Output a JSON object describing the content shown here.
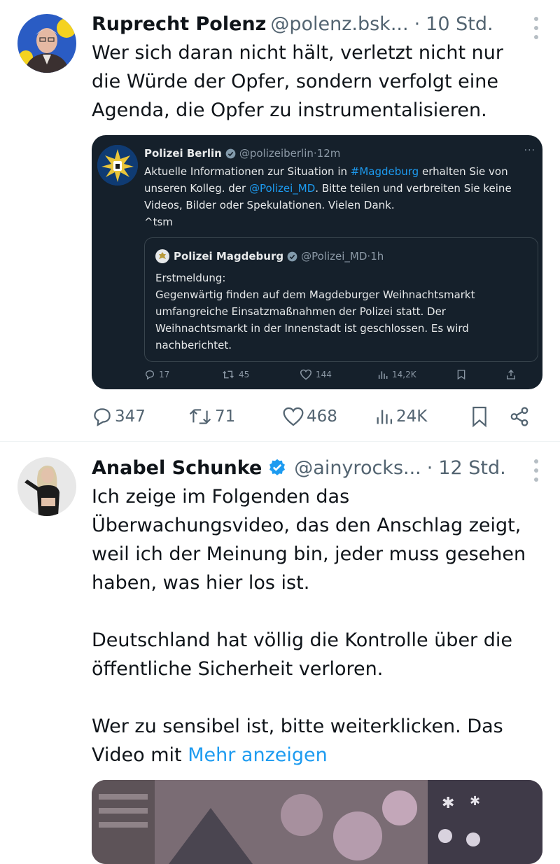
{
  "posts": [
    {
      "author": {
        "name": "Ruprecht Polenz",
        "handle": "@polenz.bsk...",
        "time": "10 Std."
      },
      "text": [
        "Wer sich daran nicht hält, verletzt nicht nur",
        "die Würde der Opfer, sondern verfolgt eine",
        "Agenda, die Opfer zu instrumentalisieren."
      ],
      "embed": {
        "author": {
          "name": "Polizei Berlin",
          "handle": "@polizeiberlin",
          "time": "12m"
        },
        "text_line1_pre": "Aktuelle Informationen zur Situation in ",
        "text_line1_link": "#Magdeburg",
        "text_line1_post": " erhalten Sie von",
        "text_line2_pre": "unseren Kolleg. der ",
        "text_line2_link": "@Polizei_MD",
        "text_line2_post": ". Bitte teilen und verbreiten Sie keine",
        "text_line3": "Videos, Bilder oder Spekulationen. Vielen Dank.",
        "text_line4": "^tsm",
        "quote": {
          "author": {
            "name": "Polizei Magdeburg",
            "handle": "@Polizei_MD",
            "time": "1h"
          },
          "text": [
            "Erstmeldung:",
            "Gegenwärtig finden auf dem Magdeburger Weihnachtsmarkt",
            "umfangreiche Einsatzmaßnahmen der Polizei statt. Der",
            "Weihnachtsmarkt in der Innenstadt ist geschlossen. Es wird",
            "nachberichtet."
          ]
        },
        "metrics": {
          "replies": "17",
          "reposts": "45",
          "likes": "144",
          "views": "14,2K"
        }
      },
      "metrics": {
        "replies": "347",
        "reposts": "71",
        "likes": "468",
        "views": "24K"
      }
    },
    {
      "author": {
        "name": "Anabel Schunke",
        "handle": "@ainyrocks...",
        "time": "12 Std."
      },
      "paragraph1": [
        "Ich zeige im Folgenden das",
        "Überwachungsvideo, das den Anschlag zeigt,",
        "weil ich der Meinung bin, jeder muss gesehen",
        "haben, was hier los ist."
      ],
      "paragraph2": [
        "Deutschland hat völlig die Kontrolle über die",
        "öffentliche Sicherheit verloren."
      ],
      "paragraph3_line1": "Wer zu sensibel ist, bitte weiterklicken. Das",
      "paragraph3_line2": "Video mit ",
      "show_more": "Mehr anzeigen"
    }
  ],
  "icons": {
    "reply": "reply-icon",
    "repost": "repost-icon",
    "like": "heart-icon",
    "views": "views-icon",
    "bookmark": "bookmark-icon",
    "share": "share-icon",
    "verified": "verified-badge-icon",
    "more": "more-options-icon"
  },
  "colors": {
    "link": "#1d9bf0",
    "verified": "#1d9bf0",
    "secondary_text": "#536471",
    "embed_background": "#15202b"
  }
}
